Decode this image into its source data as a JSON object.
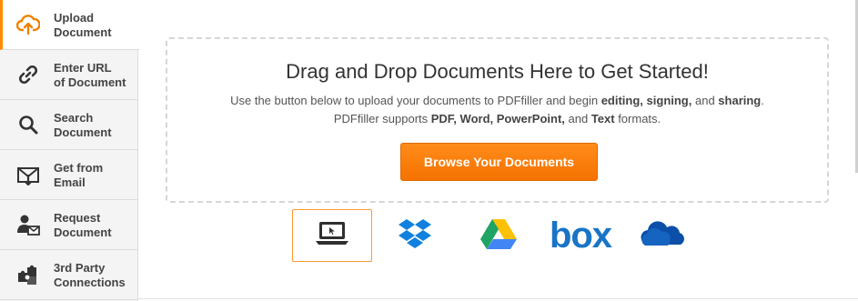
{
  "sidebar": {
    "items": [
      {
        "line1": "Upload",
        "line2": "Document"
      },
      {
        "line1": "Enter URL",
        "line2": "of Document"
      },
      {
        "line1": "Search",
        "line2": "Document"
      },
      {
        "line1": "Get from",
        "line2": "Email"
      },
      {
        "line1": "Request",
        "line2": "Document"
      },
      {
        "line1": "3rd Party",
        "line2": "Connections"
      }
    ],
    "active_index": 0,
    "icons": [
      "cloud-upload-icon",
      "link-icon",
      "search-icon",
      "email-download-icon",
      "request-user-icon",
      "puzzle-icon"
    ]
  },
  "dropzone": {
    "title": "Drag and Drop Documents Here to Get Started!",
    "line1_pre": "Use the button below to upload your documents to PDFfiller and begin ",
    "line1_b1": "editing,",
    "line1_b2": "signing,",
    "line1_mid": " and ",
    "line1_b3": "sharing",
    "line1_end": ".",
    "line2_pre": "PDFfiller supports ",
    "line2_b1": "PDF,",
    "line2_b2": "Word,",
    "line2_b3": "PowerPoint,",
    "line2_mid": " and ",
    "line2_b4": "Text",
    "line2_end": " formats.",
    "button_label": "Browse Your Documents"
  },
  "sources": {
    "items": [
      "computer-icon",
      "dropbox-icon",
      "google-drive-icon",
      "box-icon",
      "onedrive-icon"
    ],
    "box_label": "box",
    "selected_index": 0
  },
  "colors": {
    "accent": "#ff8a00",
    "box_blue": "#1a74c6",
    "dropbox_blue": "#1081de",
    "onedrive_blue": "#0b4fa8"
  }
}
